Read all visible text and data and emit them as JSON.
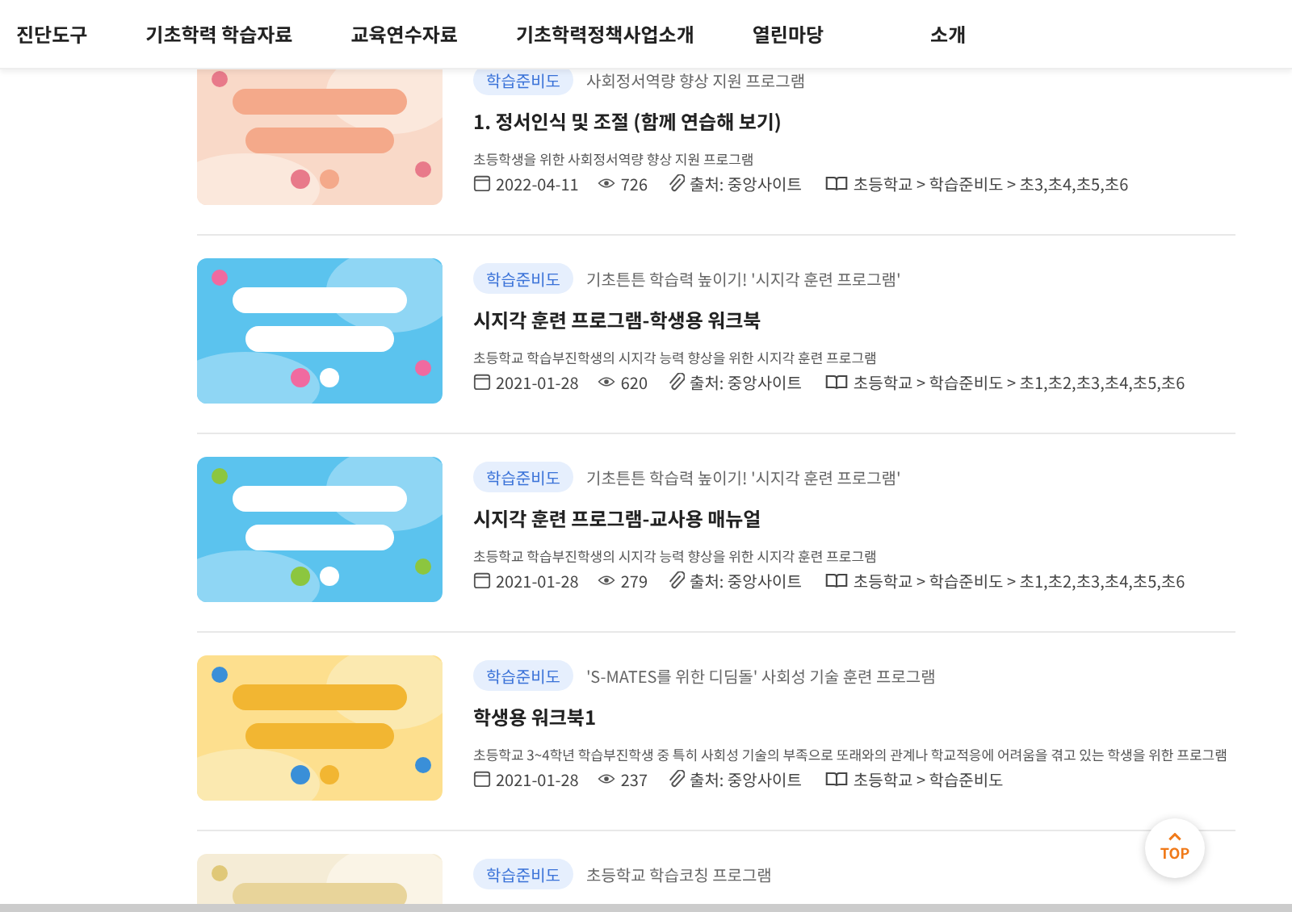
{
  "nav": {
    "items": [
      "진단도구",
      "기초학력 학습자료",
      "교육연수자료",
      "기초학력정책사업소개",
      "열린마당",
      "소개"
    ]
  },
  "posts": [
    {
      "tag": "학습준비도",
      "series": "사회정서역량 향상 지원 프로그램",
      "title": "1. 정서인식 및 조절 (함께 연습해 보기)",
      "description": "초등학생을 위한 사회정서역량 향상 지원 프로그램",
      "date": "2022-04-11",
      "views": "726",
      "source": "출처: 중앙사이트",
      "path": "초등학교 > 학습준비도 > 초3,초4,초5,초6"
    },
    {
      "tag": "학습준비도",
      "series": "기초튼튼 학습력 높이기! '시지각 훈련 프로그램'",
      "title": "시지각 훈련 프로그램-학생용 워크북",
      "description": "초등학교 학습부진학생의 시지각 능력 향상을 위한 시지각 훈련 프로그램",
      "date": "2021-01-28",
      "views": "620",
      "source": "출처: 중앙사이트",
      "path": "초등학교 > 학습준비도 > 초1,초2,초3,초4,초5,초6"
    },
    {
      "tag": "학습준비도",
      "series": "기초튼튼 학습력 높이기! '시지각 훈련 프로그램'",
      "title": "시지각 훈련 프로그램-교사용 매뉴얼",
      "description": "초등학교 학습부진학생의 시지각 능력 향상을 위한 시지각 훈련 프로그램",
      "date": "2021-01-28",
      "views": "279",
      "source": "출처: 중앙사이트",
      "path": "초등학교 > 학습준비도 > 초1,초2,초3,초4,초5,초6"
    },
    {
      "tag": "학습준비도",
      "series": "'S-MATES를 위한 디딤돌' 사회성 기술 훈련 프로그램",
      "title": "학생용 워크북1",
      "description": "초등학교 3~4학년 학습부진학생 중 특히 사회성 기술의 부족으로 또래와의 관계나 학교적응에 어려움을 겪고 있는 학생을 위한 프로그램",
      "date": "2021-01-28",
      "views": "237",
      "source": "출처: 중앙사이트",
      "path": "초등학교 > 학습준비도"
    },
    {
      "tag": "학습준비도",
      "series": "초등학교 학습코칭 프로그램"
    }
  ],
  "top_button": {
    "label": "TOP"
  }
}
